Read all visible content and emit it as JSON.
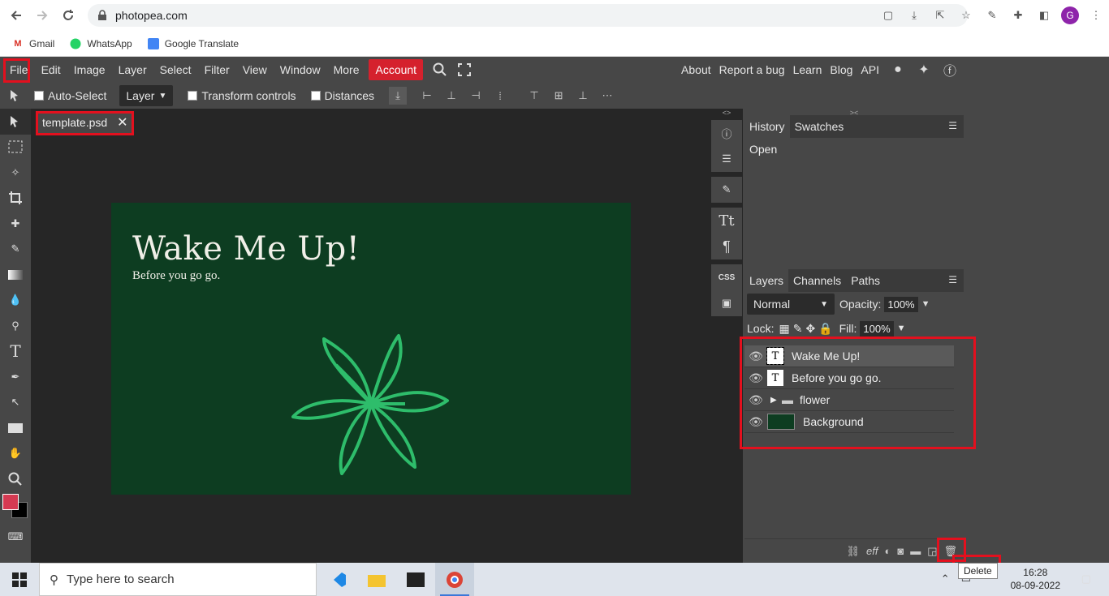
{
  "browser": {
    "url": "photopea.com",
    "avatar_letter": "G",
    "bookmarks": [
      "Gmail",
      "WhatsApp",
      "Google Translate"
    ]
  },
  "menu": {
    "items": [
      "File",
      "Edit",
      "Image",
      "Layer",
      "Select",
      "Filter",
      "View",
      "Window",
      "More"
    ],
    "account": "Account",
    "right": [
      "About",
      "Report a bug",
      "Learn",
      "Blog",
      "API"
    ]
  },
  "options": {
    "auto_select": "Auto-Select",
    "layer_select": "Layer",
    "transform": "Transform controls",
    "distances": "Distances"
  },
  "document": {
    "tab_name": "template.psd",
    "title": "Wake Me Up!",
    "subtitle": "Before you go go."
  },
  "history_panel": {
    "tabs": [
      "History",
      "Swatches"
    ],
    "entries": [
      "Open"
    ]
  },
  "layers_panel": {
    "tabs": [
      "Layers",
      "Channels",
      "Paths"
    ],
    "blend_mode": "Normal",
    "opacity_label": "Opacity:",
    "opacity": "100%",
    "lock_label": "Lock:",
    "fill_label": "Fill:",
    "fill": "100%",
    "layers": [
      {
        "name": "Wake Me Up!",
        "kind": "text"
      },
      {
        "name": "Before you go go.",
        "kind": "text"
      },
      {
        "name": "flower",
        "kind": "folder"
      },
      {
        "name": "Background",
        "kind": "image"
      }
    ],
    "tooltip": "Delete"
  },
  "taskbar": {
    "search_placeholder": "Type here to search",
    "time": "16:28",
    "date": "08-09-2022"
  },
  "colors": {
    "accent": "#d5212d",
    "canvas_bg": "#0d3d21",
    "flower": "#2ebd6b",
    "foreground": "#d53a52",
    "highlight": "#e3101e"
  }
}
